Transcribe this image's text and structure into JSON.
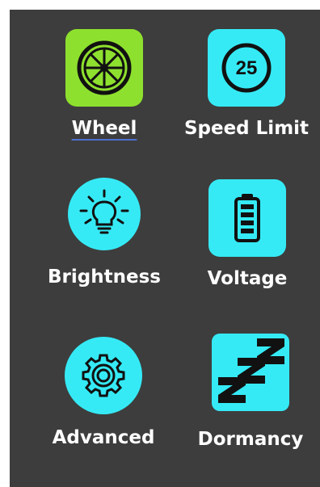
{
  "menu": {
    "items": [
      {
        "label": "Wheel",
        "icon": "wheel-icon",
        "color": "#8ee02e",
        "selected": true
      },
      {
        "label": "Speed Limit",
        "icon": "speed-limit-icon",
        "color": "#35eaf5",
        "sign_text": "25"
      },
      {
        "label": "Brightness",
        "icon": "lightbulb-icon",
        "color": "#35eaf5"
      },
      {
        "label": "Voltage",
        "icon": "battery-icon",
        "color": "#35eaf5"
      },
      {
        "label": "Advanced",
        "icon": "gear-icon",
        "color": "#35eaf5"
      },
      {
        "label": "Dormancy",
        "icon": "sleep-icon",
        "color": "#35eaf5"
      }
    ]
  },
  "colors": {
    "panel_background": "#3d3d3d",
    "label_text": "#ffffff",
    "selected_tile": "#8ee02e",
    "tile": "#35eaf5"
  }
}
